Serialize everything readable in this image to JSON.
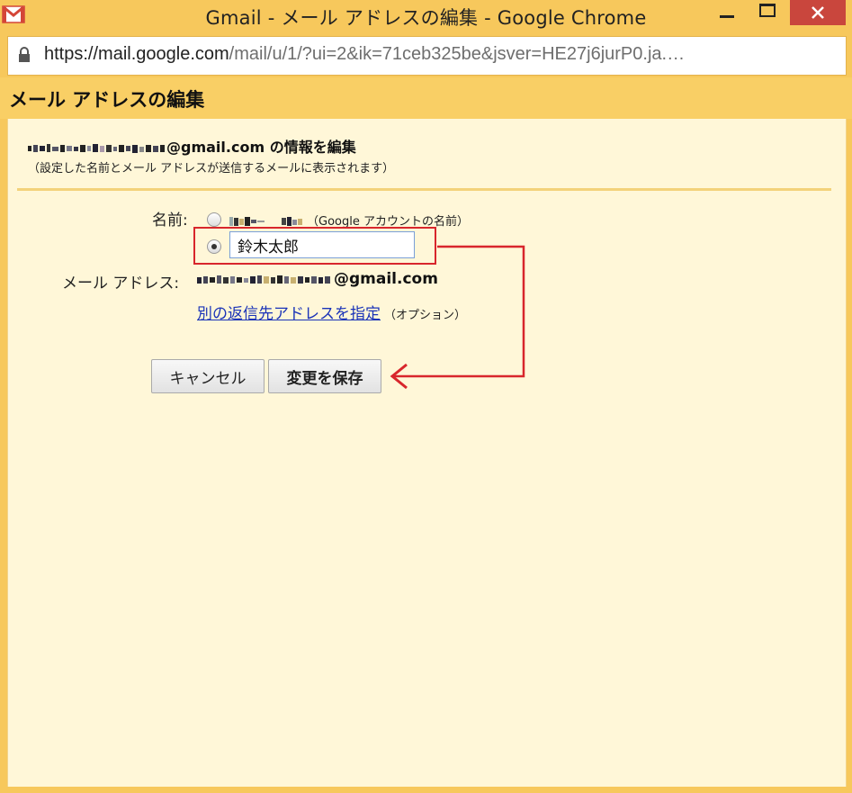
{
  "window": {
    "title": "Gmail - メール アドレスの編集 - Google Chrome",
    "url_host": "https://mail.google.com",
    "url_path": "/mail/u/1/?ui=2&ik=71ceb325be&jsver=HE27j6jurP0.ja.…"
  },
  "dialog": {
    "title": "メール アドレスの編集",
    "heading_suffix": "@gmail.com の情報を編集",
    "note": "（設定した名前とメール アドレスが送信するメールに表示されます）",
    "name_label": "名前:",
    "google_account_note": "（Google アカウントの名前）",
    "custom_name_value": "鈴木太郎",
    "email_label": "メール アドレス:",
    "email_suffix": "@gmail.com",
    "reply_to_link": "別の返信先アドレスを指定",
    "optional_note": "（オプション）",
    "cancel_label": "キャンセル",
    "save_label": "変更を保存"
  },
  "colors": {
    "title_bar": "#f7c85c",
    "panel_background": "#fff7d8",
    "annotation_red": "#d8262c",
    "link_blue": "#1a33b8",
    "close_button": "#c9463d"
  },
  "icons": [
    "gmail-logo-icon",
    "lock-icon",
    "minimize-icon",
    "maximize-icon",
    "close-icon",
    "arrow-annotation"
  ]
}
